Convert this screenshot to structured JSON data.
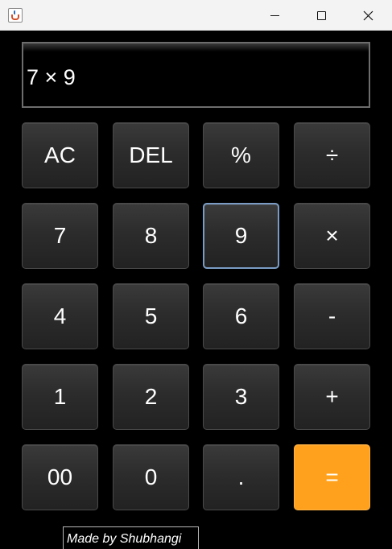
{
  "window": {
    "title": "",
    "icon": "java-icon"
  },
  "display": {
    "expression": "7 × 9"
  },
  "keys": {
    "ac": "AC",
    "del": "DEL",
    "percent": "%",
    "divide": "÷",
    "seven": "7",
    "eight": "8",
    "nine": "9",
    "multiply": "×",
    "four": "4",
    "five": "5",
    "six": "6",
    "subtract": "-",
    "one": "1",
    "two": "2",
    "three": "3",
    "add": "+",
    "double_zero": "00",
    "zero": "0",
    "decimal": ".",
    "equals": "="
  },
  "colors": {
    "background": "#000000",
    "key": "#2c2c2c",
    "equals_accent": "#ffa11c",
    "focus_ring": "#7a9cc4"
  },
  "footer": {
    "credit": "Made by Shubhangi"
  }
}
